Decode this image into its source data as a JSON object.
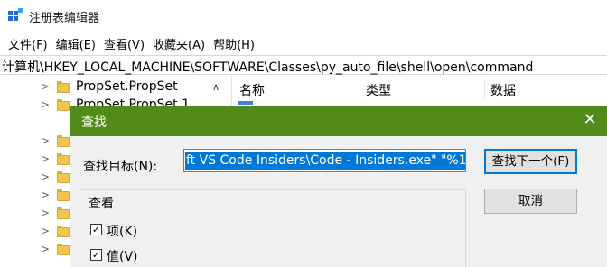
{
  "window": {
    "title": "注册表编辑器"
  },
  "menu": [
    "文件(F)",
    "编辑(E)",
    "查看(V)",
    "收藏夹(A)",
    "帮助(H)"
  ],
  "address": "计算机\\HKEY_LOCAL_MACHINE\\SOFTWARE\\Classes\\py_auto_file\\shell\\open\\command",
  "tree": {
    "items": [
      {
        "label": "PropSet.PropSet"
      },
      {
        "label": "PropSet.PropSet.1"
      }
    ]
  },
  "list": {
    "columns": [
      "名称",
      "类型",
      "数据"
    ]
  },
  "dialog": {
    "title": "查找",
    "close_glyph": "✕",
    "find_label": "查找目标(N):",
    "find_value": "ft VS Code Insiders\\Code - Insiders.exe\" \"%1\"",
    "find_next": "查找下一个(F)",
    "cancel": "取消",
    "group_title": "查看",
    "checkboxes": [
      {
        "label": "项(K)",
        "checked": true
      },
      {
        "label": "值(V)",
        "checked": true
      }
    ]
  },
  "colors": {
    "dialog_title_bg": "#528b1a",
    "selection": "#0078d7"
  }
}
